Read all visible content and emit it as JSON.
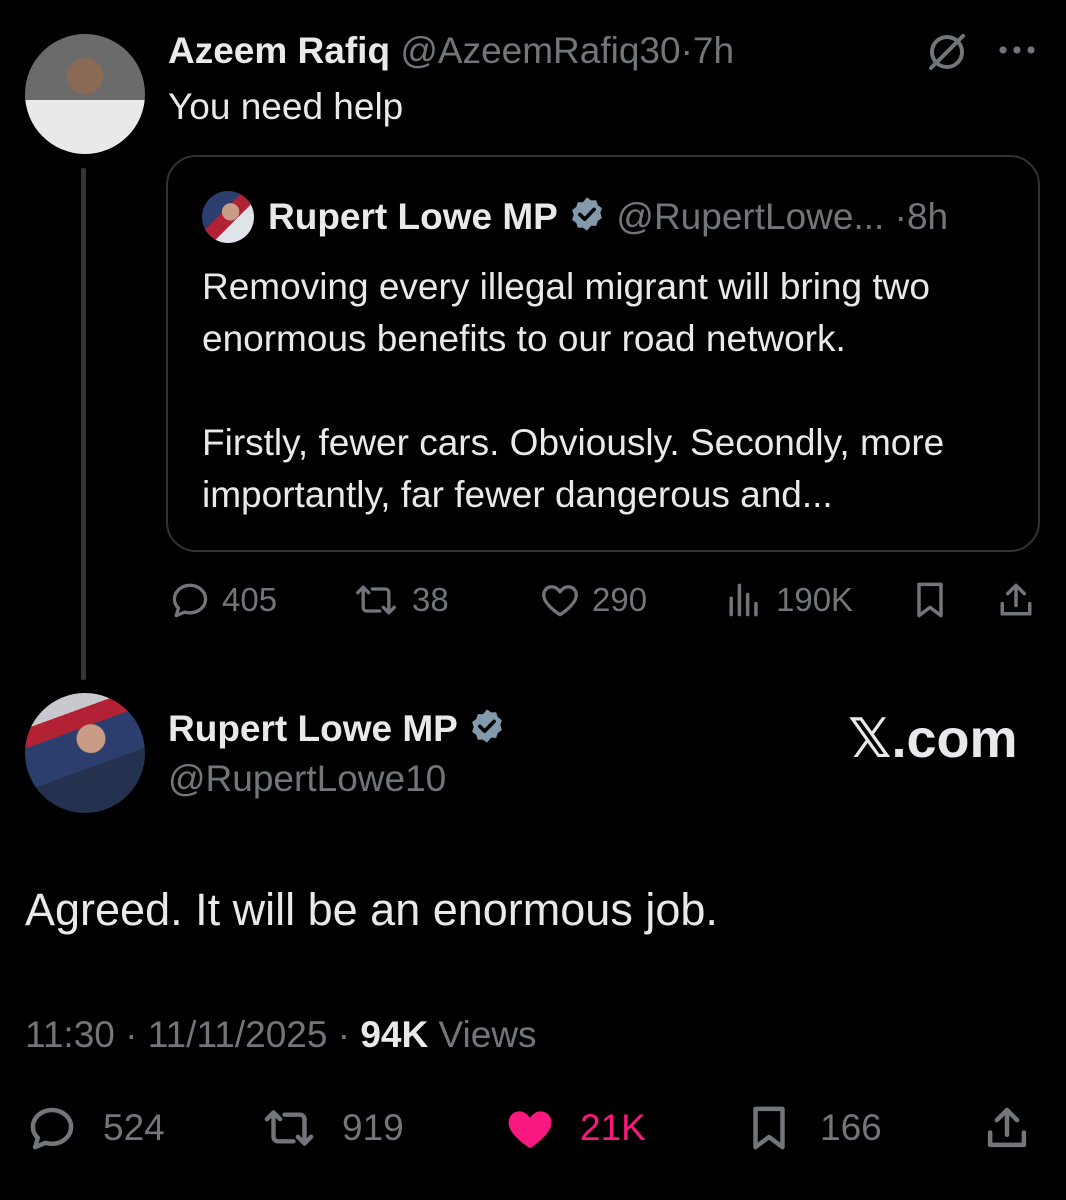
{
  "parent_tweet": {
    "display_name": "Azeem Rafiq",
    "handle": "@AzeemRafiq30",
    "separator": "·",
    "time": "7h",
    "text": "You need help",
    "quoted": {
      "display_name": "Rupert Lowe MP",
      "handle": "@RupertLowe...",
      "separator": "·",
      "time": "8h",
      "paragraph1": "Removing every illegal migrant will bring two enormous benefits to our road network.",
      "paragraph2": "Firstly, fewer cars. Obviously. Secondly, more importantly, far fewer dangerous and..."
    },
    "actions": {
      "replies": "405",
      "reposts": "38",
      "likes": "290",
      "views": "190K"
    },
    "icons": [
      "grok-icon",
      "more-icon",
      "reply-icon",
      "repost-icon",
      "like-icon",
      "views-icon",
      "bookmark-icon",
      "share-icon"
    ]
  },
  "main_tweet": {
    "display_name": "Rupert Lowe MP",
    "handle": "@RupertLowe10",
    "watermark": "𝕏.com",
    "text": "Agreed. It will be an enormous job.",
    "time": "11:30",
    "dot": "·",
    "date": "11/11/2025",
    "views_count": "94K",
    "views_label": "Views",
    "actions": {
      "replies": "524",
      "reposts": "919",
      "likes": "21K",
      "bookmarks": "166"
    }
  },
  "colors": {
    "background": "#000000",
    "text": "#e7e9ea",
    "secondary": "#71767b",
    "verified": "#829aab",
    "like_active": "#f91880",
    "thread_line": "#333639"
  }
}
